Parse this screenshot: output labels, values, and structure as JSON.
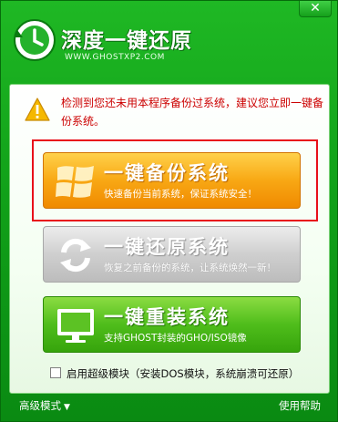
{
  "window": {
    "close_label": "✕"
  },
  "header": {
    "app_title": "深度一键还原",
    "app_url": "WWW.GHOSTXP2.COM"
  },
  "notice": {
    "icon": "warning-icon",
    "text": "检测到您还未用本程序备份过系统，建议您立即一键备份系统。"
  },
  "actions": {
    "backup": {
      "icon": "windows-logo-icon",
      "title": "一键备份系统",
      "subtitle": "快速备份当前系统，保证系统安全！"
    },
    "restore": {
      "icon": "refresh-arrows-icon",
      "title": "一键还原系统",
      "subtitle": "恢复之前备份的系统，让系统焕然一新！"
    },
    "reinstall": {
      "icon": "monitor-icon",
      "title": "一键重装系统",
      "subtitle": "支持GHOST封装的GHO/ISO镜像"
    }
  },
  "options": {
    "advanced_module_label": "启用超级模块（安装DOS模块，系统崩溃可还原）",
    "advanced_module_checked": false
  },
  "footer": {
    "advanced_mode_label": "高级模式",
    "help_label": "使用帮助"
  },
  "colors": {
    "window_green": "#11a119",
    "warning_red": "#cc0000",
    "backup_orange": "#f8a814",
    "restore_gray": "#cfcfcf",
    "reinstall_green": "#4fbd1b",
    "highlight_red": "#e8101a"
  }
}
